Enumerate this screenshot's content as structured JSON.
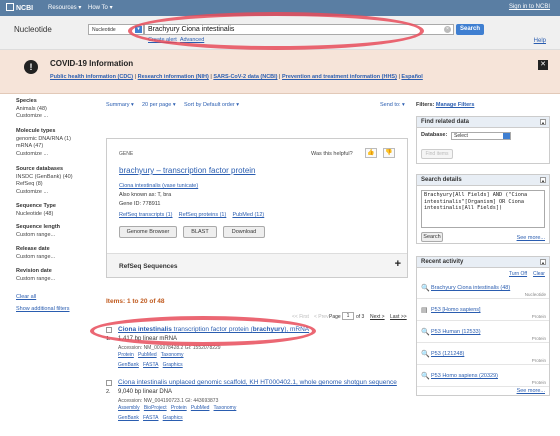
{
  "topbar": {
    "logo": "NCBI",
    "resources": "Resources",
    "howto": "How To",
    "signin": "Sign in to NCBI"
  },
  "search": {
    "db_label": "Nucleotide",
    "db_select": "Nucleotide",
    "query": "Brachyury Ciona intestinalis",
    "search_button": "Search",
    "create_alert": "Create alert",
    "advanced": "Advanced",
    "help": "Help"
  },
  "covid": {
    "title": "COVID-19 Information",
    "links": [
      "Public health information (CDC)",
      "Research information (NIH)",
      "SARS-CoV-2 data (NCBI)",
      "Prevention and treatment information (HHS)",
      "Español"
    ]
  },
  "filters_left": [
    {
      "heading": "Species",
      "items": [
        "Animals (48)",
        "Customize ..."
      ]
    },
    {
      "heading": "Molecule types",
      "items": [
        "genomic DNA/RNA (1)",
        "mRNA (47)",
        "Customize ..."
      ]
    },
    {
      "heading": "Source databases",
      "items": [
        "INSDC (GenBank) (40)",
        "RefSeq (8)",
        "Customize ..."
      ]
    },
    {
      "heading": "Sequence Type",
      "items": [
        "Nucleotide (48)"
      ]
    },
    {
      "heading": "Sequence length",
      "items": [
        "Custom range..."
      ]
    },
    {
      "heading": "Release date",
      "items": [
        "Custom range..."
      ]
    },
    {
      "heading": "Revision date",
      "items": [
        "Custom range..."
      ]
    }
  ],
  "clear_all": "Clear all",
  "show_additional": "Show additional filters",
  "summary_bar": {
    "summary": "Summary",
    "per_page": "20 per page",
    "sort": "Sort by Default order",
    "send_to": "Send to:"
  },
  "gene_card": {
    "label": "GENE",
    "helpful": "Was this helpful?",
    "title": "brachyury – transcription factor protein",
    "organism": "Ciona intestinalis (vase tunicate)",
    "aka": "Also known as: T, bra",
    "gene_id": "Gene ID: 778911",
    "links": [
      "RefSeq transcripts (1)",
      "RefSeq proteins (1)",
      "PubMed (12)"
    ],
    "buttons": [
      "Genome Browser",
      "BLAST",
      "Download"
    ],
    "refseq": "RefSeq Sequences"
  },
  "items_text": "Items: 1 to 20 of 48",
  "pager": {
    "first": "<< First",
    "prev": "< Prev",
    "page_label": "Page",
    "page": "1",
    "of": "of 3",
    "next": "Next >",
    "last": "Last >>"
  },
  "results": [
    {
      "num": "1.",
      "title_pre": "Ciona intestinalis",
      "title_mid": " transcription factor protein (",
      "title_bold": "brachyury",
      "title_post": "), mRNA",
      "desc": "1,417 bp linear mRNA",
      "accession": "Accession: NM_001078428.2   GI: 1552078229",
      "links1": [
        "Protein",
        "PubMed",
        "Taxonomy"
      ],
      "links2": [
        "GenBank",
        "FASTA",
        "Graphics"
      ]
    },
    {
      "num": "2.",
      "title": "Ciona intestinalis unplaced genomic scaffold, KH HT000402.1, whole genome shotgun sequence",
      "desc": "9,040 bp linear DNA",
      "accession": "Accession: NW_004190723.1   GI: 443693873",
      "links1": [
        "Assembly",
        "BioProject",
        "Protein",
        "PubMed",
        "Taxonomy"
      ],
      "links2": [
        "GenBank",
        "FASTA",
        "Graphics"
      ]
    }
  ],
  "right": {
    "filters_label": "Filters:",
    "manage_filters": "Manage Filters",
    "find_related": "Find related data",
    "database_label": "Database:",
    "database_select": "Select",
    "find_items": "Find items",
    "search_details": "Search details",
    "search_details_text": "Brachyury[All Fields] AND (\"Ciona intestinalis\"[Organism] OR Ciona intestinalis[All Fields])",
    "search_btn": "Search",
    "see_more": "See more...",
    "recent_activity": "Recent activity",
    "turn_off": "Turn Off",
    "clear": "Clear",
    "activity": [
      {
        "text": "Brachyury Ciona intestinalis (48)",
        "db": "Nucleotide",
        "icon": "search-icon"
      },
      {
        "text": "P53 [Homo sapiens]",
        "db": "Protein",
        "icon": "document-icon"
      },
      {
        "text": "P53 Human (12533)",
        "db": "Protein",
        "icon": "search-icon"
      },
      {
        "text": "P53 (121248)",
        "db": "Protein",
        "icon": "search-icon"
      },
      {
        "text": "P53 Homo sapiens (20329)",
        "db": "Protein",
        "icon": "search-icon"
      }
    ],
    "see_more2": "See more..."
  },
  "colors": {
    "topbar": "#5a7ea3",
    "banner": "#f6e4d9",
    "link": "#2a5db0",
    "items": "#c05a1e",
    "oval": "#e74c5a"
  }
}
